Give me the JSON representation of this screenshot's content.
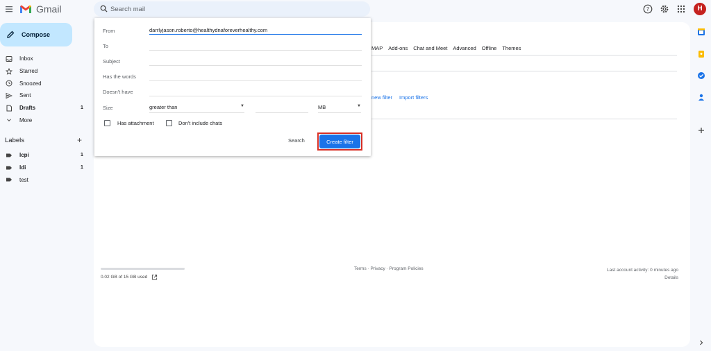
{
  "app": {
    "name": "Gmail"
  },
  "search": {
    "placeholder": "Search mail"
  },
  "avatar": {
    "initial": "H"
  },
  "compose": {
    "label": "Compose"
  },
  "nav": [
    {
      "label": "Inbox",
      "count": "",
      "icon": "inbox-icon"
    },
    {
      "label": "Starred",
      "count": "",
      "icon": "star-icon"
    },
    {
      "label": "Snoozed",
      "count": "",
      "icon": "clock-icon"
    },
    {
      "label": "Sent",
      "count": "",
      "icon": "send-icon"
    },
    {
      "label": "Drafts",
      "count": "1",
      "icon": "draft-icon"
    },
    {
      "label": "More",
      "count": "",
      "icon": "chevron-down-icon"
    }
  ],
  "labels": {
    "heading": "Labels",
    "items": [
      {
        "label": "lcpi",
        "count": "1"
      },
      {
        "label": "ldi",
        "count": "1"
      },
      {
        "label": "test",
        "count": ""
      }
    ]
  },
  "settings_tabs": [
    "MAP",
    "Add-ons",
    "Chat and Meet",
    "Advanced",
    "Offline",
    "Themes"
  ],
  "filter_links": [
    "new filter",
    "Import filters"
  ],
  "filter_dialog": {
    "from_label": "From",
    "from_value": "darrlyjason.roberto@healthydnaforeverhealthy.com",
    "to_label": "To",
    "subject_label": "Subject",
    "has_words_label": "Has the words",
    "doesnt_have_label": "Doesn't have",
    "size_label": "Size",
    "size_comparator": "greater than",
    "size_unit": "MB",
    "has_attachment_label": "Has attachment",
    "dont_include_chats_label": "Don't include chats",
    "search_button": "Search",
    "create_filter_button": "Create filter"
  },
  "footer": {
    "usage": "0.02 GB of 15 GB used",
    "links": "Terms · Privacy · Program Policies",
    "activity": "Last account activity: 0 minutes ago",
    "details": "Details"
  },
  "colors": {
    "accent": "#1a73e8",
    "compose_bg": "#c2e7ff",
    "highlight": "#d93025",
    "avatar_bg": "#c5221f"
  }
}
